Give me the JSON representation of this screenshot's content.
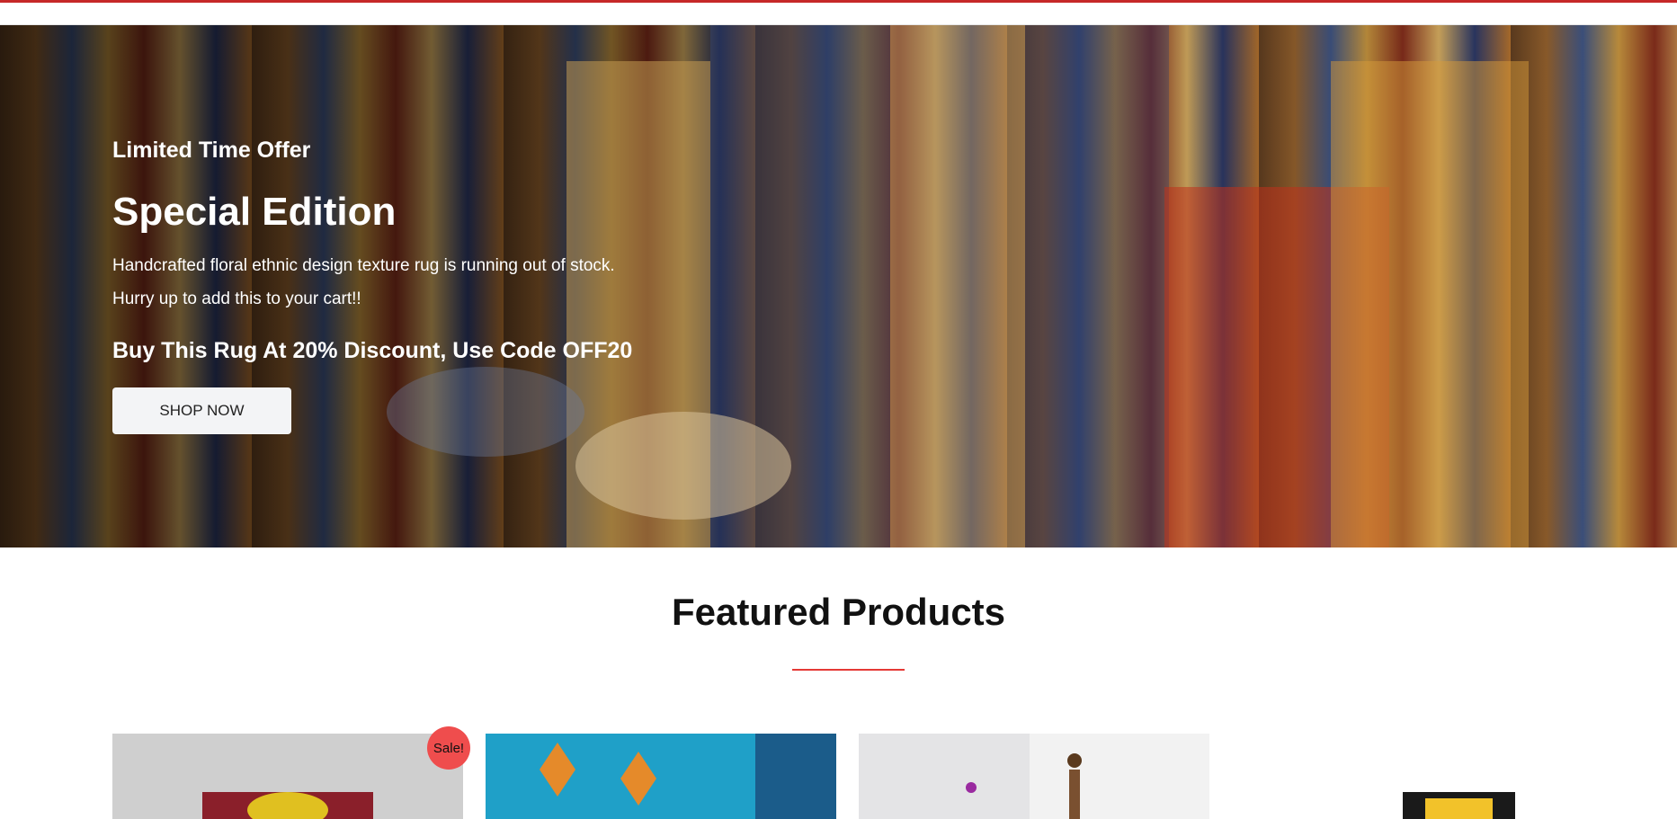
{
  "hero": {
    "eyebrow": "Limited Time Offer",
    "title": "Special Edition",
    "description_line1": "Handcrafted floral ethnic design texture rug is running out of stock.",
    "description_line2": "Hurry up to add this to your cart!!",
    "promo": "Buy This Rug At 20% Discount, Use Code OFF20",
    "button_label": "SHOP NOW"
  },
  "featured": {
    "title": "Featured Products",
    "products": [
      {
        "badge": "Sale!"
      },
      {
        "badge": ""
      },
      {
        "badge": ""
      },
      {
        "badge": ""
      }
    ]
  },
  "colors": {
    "accent": "#e53935",
    "top_bar": "#c62828",
    "sale_badge": "#ef4d4d"
  }
}
